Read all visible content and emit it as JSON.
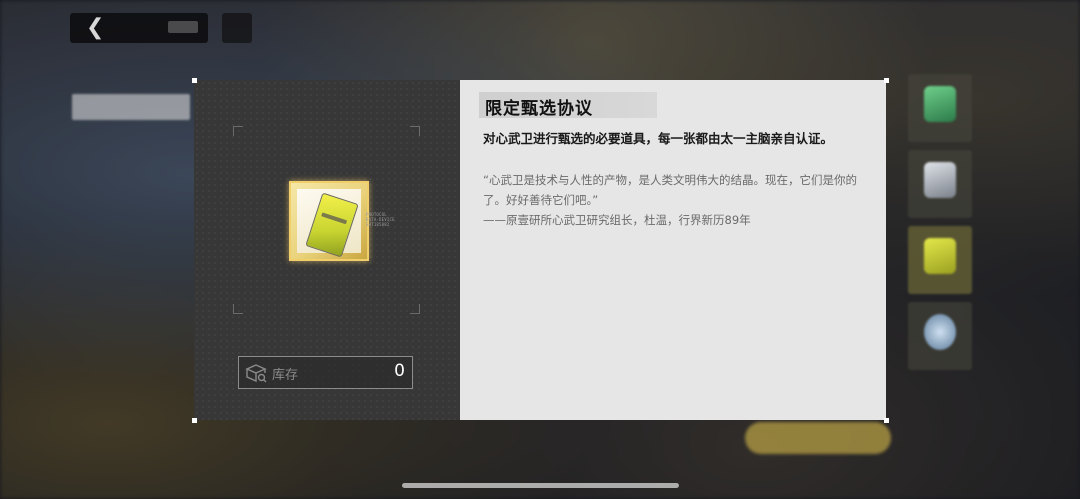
{
  "top_hud": {
    "back_icon": "chevron-left-icon"
  },
  "item": {
    "name": "限定甄选协议",
    "description": "对心武卫进行甄选的必要道具，每一张都由太一主脑亲自认证。",
    "flavor_quote": "“心武卫是技术与人性的产物，是人类文明伟大的结晶。现在，它们是你的了。好好善待它们吧。”",
    "flavor_attribution": "——原壹研所心武卫研究组长，杜温，行界新历89年",
    "card_micro_text": [
      "PROTOCOL",
      "DATA-DEVICE",
      "SHT185082"
    ]
  },
  "stock": {
    "label": "库存",
    "value": "0",
    "icon": "box-icon"
  },
  "colors": {
    "card_gold": "#f0cf6a",
    "panel_dark": "#373737",
    "panel_light": "#e6e6e6"
  }
}
